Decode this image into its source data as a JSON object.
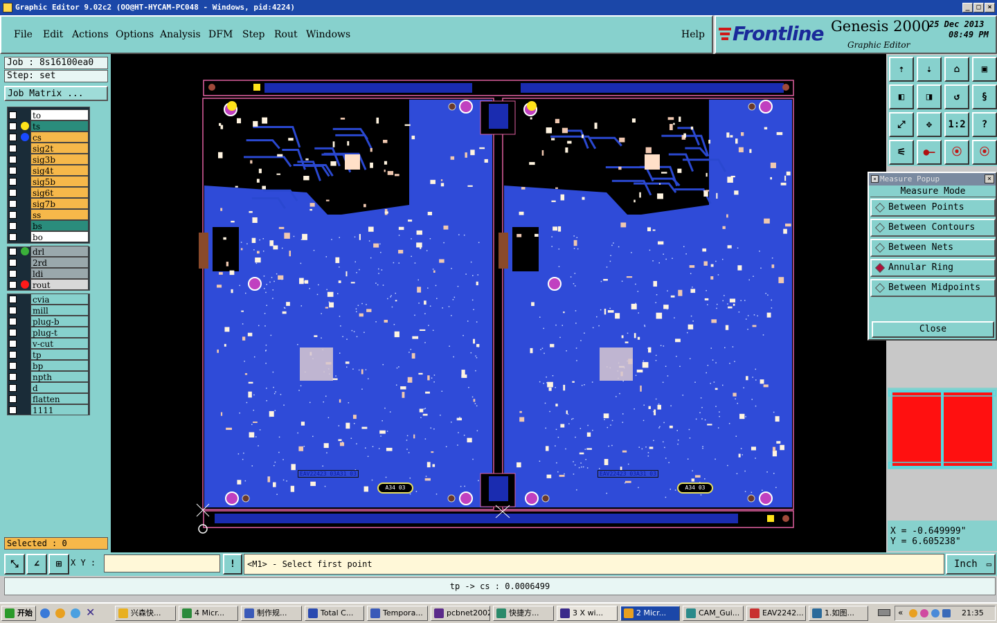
{
  "window": {
    "title": "Graphic Editor 9.02c2  (OO@HT-HYCAM-PC048 - Windows, pid:4224)"
  },
  "menu": [
    "File",
    "Edit",
    "Actions",
    "Options",
    "Analysis",
    "DFM",
    "Step",
    "Rout",
    "Windows"
  ],
  "help": "Help",
  "brand": {
    "logo": "Frontline",
    "product": "Genesis 2000",
    "sub": "Graphic Editor",
    "date": "25 Dec 2013",
    "time": "08:49 PM"
  },
  "job": {
    "job_label": "Job : 8s16100ea0",
    "step_label": "Step: set",
    "matrix_button": "Job Matrix ..."
  },
  "layers_board": [
    {
      "name": "to",
      "color": "#ffffff",
      "dot": ""
    },
    {
      "name": "ts",
      "color": "#2a8c7c",
      "dot": "#ffe31a"
    },
    {
      "name": "cs",
      "color": "#f6b84a",
      "dot": "#1a4aff"
    },
    {
      "name": "sig2t",
      "color": "#f6b84a",
      "dot": ""
    },
    {
      "name": "sig3b",
      "color": "#f6b84a",
      "dot": ""
    },
    {
      "name": "sig4t",
      "color": "#f6b84a",
      "dot": ""
    },
    {
      "name": "sig5b",
      "color": "#f6b84a",
      "dot": ""
    },
    {
      "name": "sig6t",
      "color": "#f6b84a",
      "dot": ""
    },
    {
      "name": "sig7b",
      "color": "#f6b84a",
      "dot": ""
    },
    {
      "name": "ss",
      "color": "#f6b84a",
      "dot": ""
    },
    {
      "name": "bs",
      "color": "#2a8c7c",
      "dot": ""
    },
    {
      "name": "bo",
      "color": "#ffffff",
      "dot": ""
    }
  ],
  "layers_drill": [
    {
      "name": "drl",
      "color": "#9aa8ac",
      "dot": "#3ab03a"
    },
    {
      "name": "2rd",
      "color": "#9aa8ac",
      "dot": ""
    },
    {
      "name": "ldi",
      "color": "#9aa8ac",
      "dot": ""
    },
    {
      "name": "rout",
      "color": "#d8d8d8",
      "dot": "#ff1a1a"
    }
  ],
  "layers_misc": [
    "cvia",
    "mill",
    "plug-b",
    "plug-t",
    "v-cut",
    "tp",
    "bp",
    "npth",
    "d",
    "flatten",
    "1111"
  ],
  "selected": "Selected : 0",
  "board_labels": {
    "part_left": "EAV22423 03A31 03",
    "part_right": "EAV22423 03A31 03",
    "tag": "A34 03"
  },
  "toolbar_icons": [
    "home-up-icon",
    "home-down-icon",
    "zoom-home-icon",
    "zoom-window-icon",
    "pan-left-icon",
    "pan-right-icon",
    "undo-icon",
    "redo-icon",
    "fit-icon",
    "center-icon",
    "ratio-icon",
    "help-icon",
    "measure-tool-icon",
    "snap-icon",
    "layer-toggle-icon",
    "layer-compare-icon"
  ],
  "toolbar_labels": {
    "ratio": "1:2",
    "help": "?"
  },
  "measure": {
    "title": "Measure Popup",
    "mode_label": "Measure Mode",
    "options": [
      "Between Points",
      "Between Contours",
      "Between Nets",
      "Annular Ring",
      "Between Midpoints"
    ],
    "selected": "Annular Ring",
    "close": "Close"
  },
  "coords": {
    "x": "X = -0.649999\"",
    "y": "Y = 6.605238\""
  },
  "bottom": {
    "xy_label": "X Y :",
    "xy_value": "",
    "prompt": "<M1> - Select first point",
    "units": "Inch",
    "info_button": "!"
  },
  "status": "tp -> cs : 0.0006499",
  "taskbar": {
    "start": "开始",
    "tasks": [
      "兴森快...",
      "4 Micr...",
      "制作规...",
      "Total C...",
      "Tempora...",
      "pcbnet2002",
      "快捷方...",
      "3 X wi...",
      "2 Micr...",
      "CAM_Gui...",
      "EAV2242...",
      "1.如图..."
    ],
    "clock": "21:35"
  }
}
